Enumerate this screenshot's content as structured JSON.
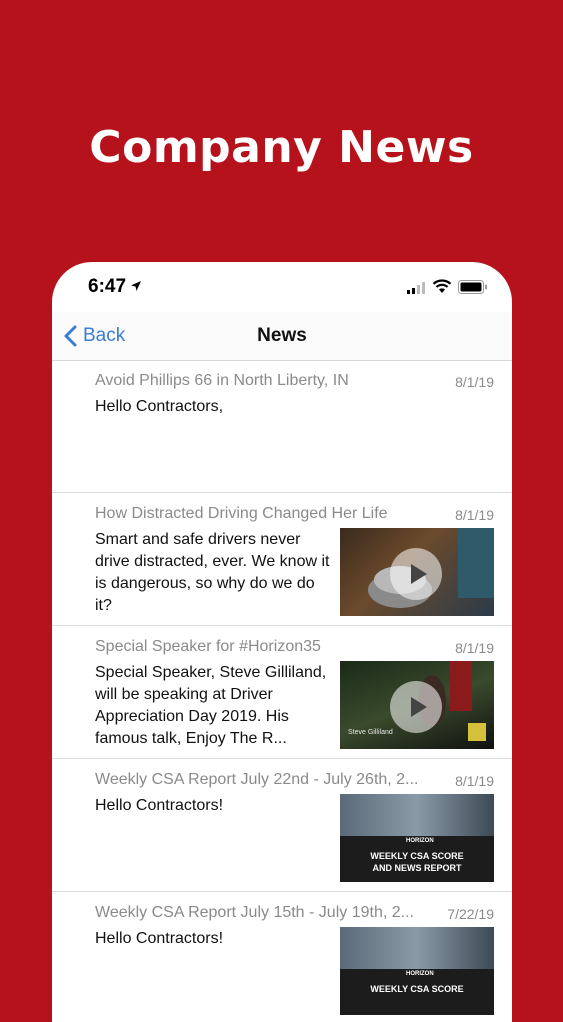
{
  "promo": {
    "headline": "Company News"
  },
  "status_bar": {
    "time": "6:47"
  },
  "nav": {
    "back_label": "Back",
    "title": "News"
  },
  "news": [
    {
      "title": "Avoid Phillips 66 in North Liberty, IN",
      "date": "8/1/19",
      "body": "Hello Contractors,",
      "thumbnail": null
    },
    {
      "title": "How Distracted Driving Changed Her Life",
      "date": "8/1/19",
      "body": "Smart and safe drivers never drive distracted, ever. We know it is dangerous, so why do we do it?",
      "thumbnail": "video"
    },
    {
      "title": "Special Speaker for #Horizon35",
      "date": "8/1/19",
      "body": "Special Speaker, Steve Gilliland, will be speaking at Driver Appreciation Day 2019. His famous talk, Enjoy The R...",
      "thumbnail": "video"
    },
    {
      "title": "Weekly CSA Report July 22nd - July 26th, 2...",
      "date": "8/1/19",
      "body": "Hello Contractors!",
      "thumbnail": "csa"
    },
    {
      "title": "Weekly CSA Report July 15th - July 19th, 2...",
      "date": "7/22/19",
      "body": "Hello Contractors!",
      "thumbnail": "csa"
    }
  ],
  "thumbnails": {
    "speaker_caption": "Steve Gilliland",
    "csa_logo": "HORIZON",
    "csa_line1": "WEEKLY CSA SCORE",
    "csa_line2": "AND NEWS REPORT"
  },
  "colors": {
    "brand_red": "#b5121b",
    "link_blue": "#3a7bd5"
  }
}
